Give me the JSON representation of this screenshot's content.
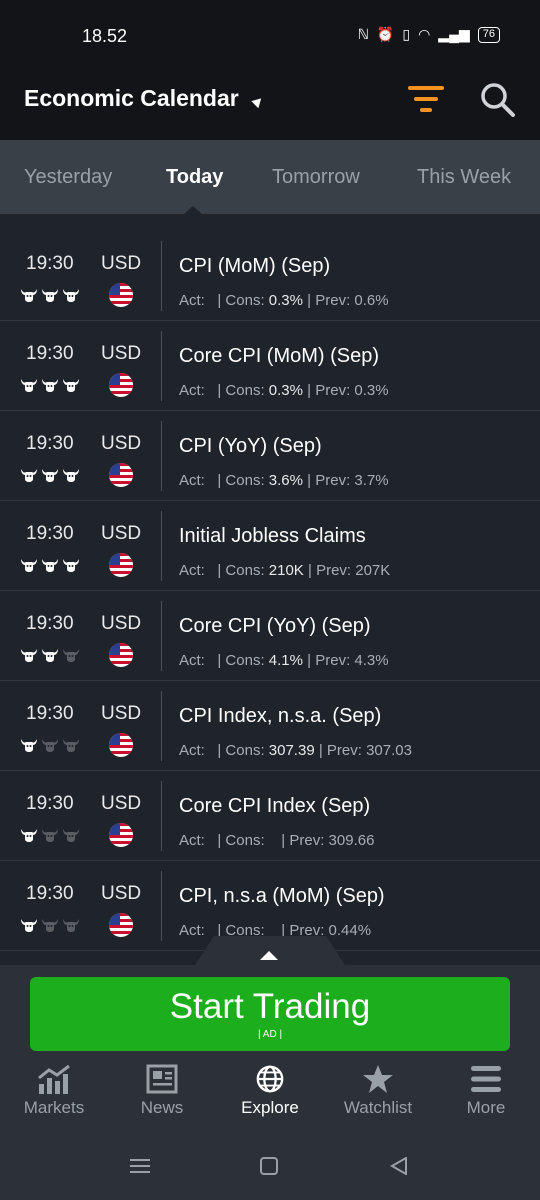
{
  "status": {
    "time": "18.52",
    "battery": "76"
  },
  "header": {
    "title": "Economic Calendar"
  },
  "tabs": [
    "Yesterday",
    "Today",
    "Tomorrow",
    "This Week"
  ],
  "events": [
    {
      "time": "19:30",
      "currency": "USD",
      "importance": 3,
      "name": "CPI (MoM) (Sep)",
      "act_label": "Act:",
      "cons_label": "| Cons:",
      "cons": "0.3%",
      "prev_label": "| Prev:",
      "prev": "0.6%"
    },
    {
      "time": "19:30",
      "currency": "USD",
      "importance": 3,
      "name": "Core CPI (MoM) (Sep)",
      "act_label": "Act:",
      "cons_label": "| Cons:",
      "cons": "0.3%",
      "prev_label": "| Prev:",
      "prev": "0.3%"
    },
    {
      "time": "19:30",
      "currency": "USD",
      "importance": 3,
      "name": "CPI (YoY) (Sep)",
      "act_label": "Act:",
      "cons_label": "| Cons:",
      "cons": "3.6%",
      "prev_label": "| Prev:",
      "prev": "3.7%"
    },
    {
      "time": "19:30",
      "currency": "USD",
      "importance": 3,
      "name": "Initial Jobless Claims",
      "act_label": "Act:",
      "cons_label": "| Cons:",
      "cons": "210K",
      "prev_label": "| Prev:",
      "prev": "207K"
    },
    {
      "time": "19:30",
      "currency": "USD",
      "importance": 2,
      "name": "Core CPI (YoY) (Sep)",
      "act_label": "Act:",
      "cons_label": "| Cons:",
      "cons": "4.1%",
      "prev_label": "| Prev:",
      "prev": "4.3%"
    },
    {
      "time": "19:30",
      "currency": "USD",
      "importance": 1,
      "name": "CPI Index, n.s.a. (Sep)",
      "act_label": "Act:",
      "cons_label": "| Cons:",
      "cons": "307.39",
      "prev_label": "| Prev:",
      "prev": "307.03"
    },
    {
      "time": "19:30",
      "currency": "USD",
      "importance": 1,
      "name": "Core CPI Index (Sep)",
      "act_label": "Act:",
      "cons_label": "| Cons:",
      "cons": "",
      "prev_label": "| Prev:",
      "prev": "309.66"
    },
    {
      "time": "19:30",
      "currency": "USD",
      "importance": 1,
      "name": "CPI, n.s.a (MoM) (Sep)",
      "act_label": "Act:",
      "cons_label": "| Cons:",
      "cons": "",
      "prev_label": "| Prev:",
      "prev": "0.44%"
    }
  ],
  "cta": {
    "label": "Start Trading",
    "ad": "| AD |"
  },
  "nav": [
    {
      "label": "Markets",
      "icon": "chart-icon"
    },
    {
      "label": "News",
      "icon": "news-icon"
    },
    {
      "label": "Explore",
      "icon": "globe-icon",
      "active": true
    },
    {
      "label": "Watchlist",
      "icon": "star-icon"
    },
    {
      "label": "More",
      "icon": "menu-icon"
    }
  ],
  "colors": {
    "accent": "#f7931e",
    "cta": "#1cae1c",
    "header": "#121417",
    "tabs": "#394048",
    "bull_on": "#ffffff",
    "bull_off": "#5a5e63"
  }
}
